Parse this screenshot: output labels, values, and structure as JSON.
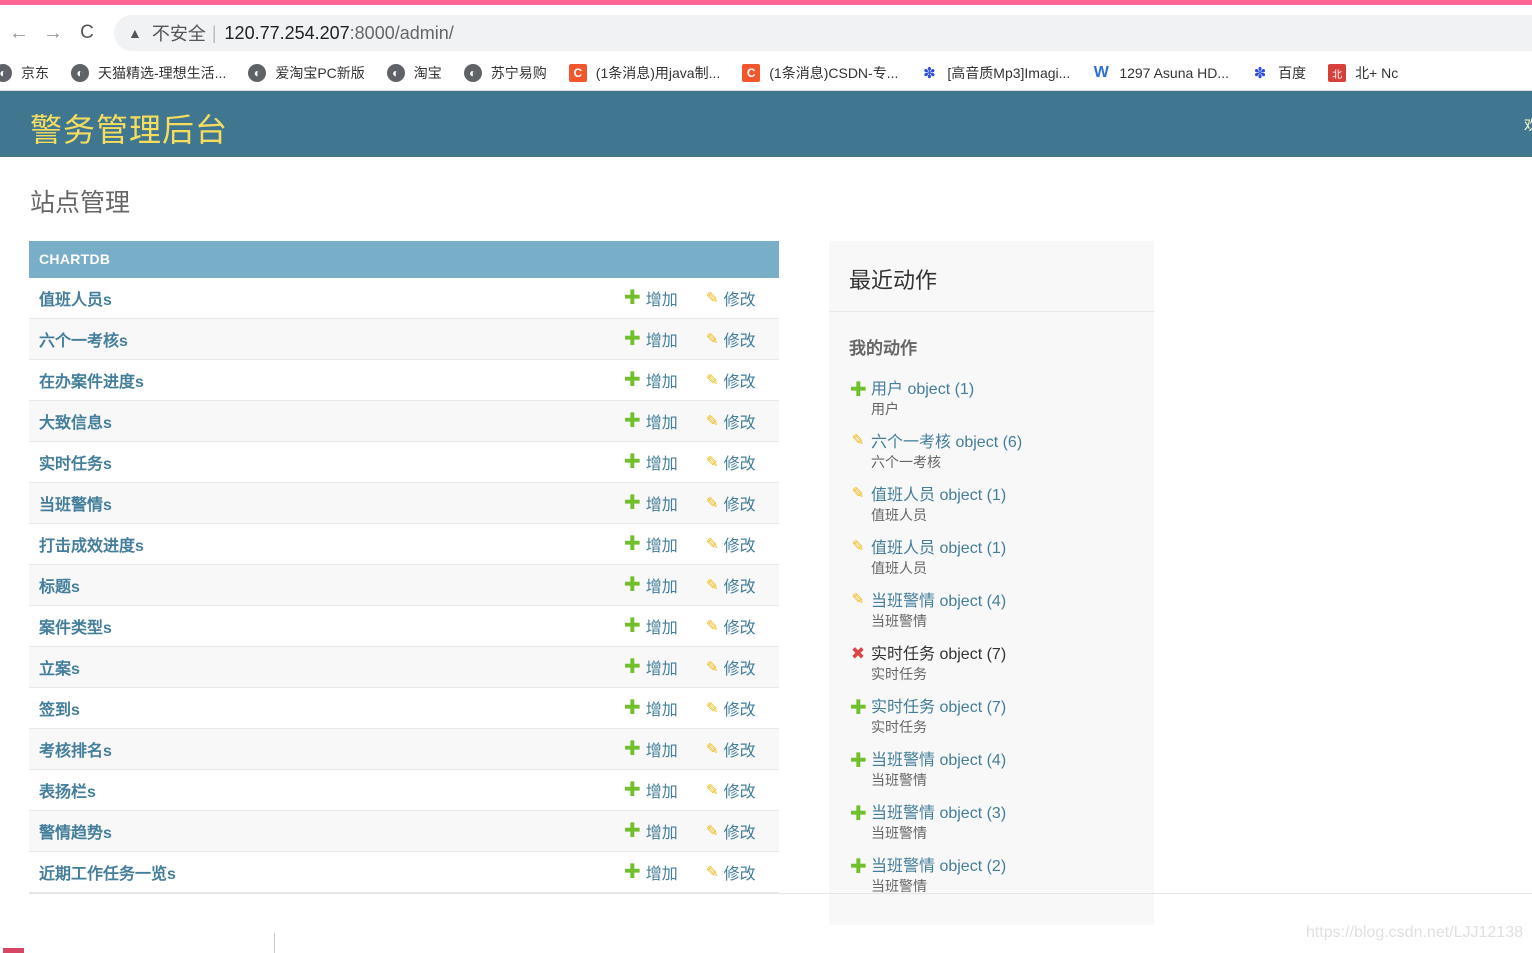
{
  "browser": {
    "back_icon": "←",
    "forward_icon": "→",
    "reload_icon": "C",
    "warning_icon": "▲",
    "insecure_label": "不安全",
    "separator": "|",
    "url_host": "120.77.254.207",
    "url_path": ":8000/admin/",
    "bookmarks": [
      {
        "icon": "globe-icon",
        "glyph": "◐",
        "label": "京东"
      },
      {
        "icon": "globe-icon",
        "glyph": "◐",
        "label": "天猫精选-理想生活..."
      },
      {
        "icon": "globe-icon",
        "glyph": "◐",
        "label": "爱淘宝PC新版"
      },
      {
        "icon": "globe-icon",
        "glyph": "◐",
        "label": "淘宝"
      },
      {
        "icon": "globe-icon",
        "glyph": "◐",
        "label": "苏宁易购"
      },
      {
        "icon": "csdn-icon",
        "glyph": "C",
        "label": "(1条消息)用java制..."
      },
      {
        "icon": "csdn-icon",
        "glyph": "C",
        "label": "(1条消息)CSDN-专..."
      },
      {
        "icon": "baidu-paw-icon",
        "glyph": "✽",
        "label": "[高音质Mp3]Imagi..."
      },
      {
        "icon": "w-icon",
        "glyph": "W",
        "label": "1297 Asuna HD..."
      },
      {
        "icon": "baidu-paw-icon",
        "glyph": "✽",
        "label": "百度"
      },
      {
        "icon": "seal-icon",
        "glyph": "北",
        "label": "北+ Nc"
      }
    ]
  },
  "header": {
    "brand": "警务管理后台",
    "user_fragment": "欢"
  },
  "page": {
    "title": "站点管理"
  },
  "module": {
    "caption": "CHARTDB",
    "add_label": "增加",
    "change_label": "修改",
    "add_glyph": "✚",
    "change_glyph": "✎",
    "models": [
      "值班人员s",
      "六个一考核s",
      "在办案件进度s",
      "大致信息s",
      "实时任务s",
      "当班警情s",
      "打击成效进度s",
      "标题s",
      "案件类型s",
      "立案s",
      "签到s",
      "考核排名s",
      "表扬栏s",
      "警情趋势s",
      "近期工作任务一览s"
    ]
  },
  "recent": {
    "title": "最近动作",
    "mine_label": "我的动作",
    "actions": [
      {
        "type": "add",
        "glyph": "✚",
        "link": "用户 object (1)",
        "content_type": "用户"
      },
      {
        "type": "change",
        "glyph": "✎",
        "link": "六个一考核 object (6)",
        "content_type": "六个一考核"
      },
      {
        "type": "change",
        "glyph": "✎",
        "link": "值班人员 object (1)",
        "content_type": "值班人员"
      },
      {
        "type": "change",
        "glyph": "✎",
        "link": "值班人员 object (1)",
        "content_type": "值班人员"
      },
      {
        "type": "change",
        "glyph": "✎",
        "link": "当班警情 object (4)",
        "content_type": "当班警情"
      },
      {
        "type": "delete",
        "glyph": "✖",
        "link": "实时任务 object (7)",
        "content_type": "实时任务"
      },
      {
        "type": "add",
        "glyph": "✚",
        "link": "实时任务 object (7)",
        "content_type": "实时任务"
      },
      {
        "type": "add",
        "glyph": "✚",
        "link": "当班警情 object (4)",
        "content_type": "当班警情"
      },
      {
        "type": "add",
        "glyph": "✚",
        "link": "当班警情 object (3)",
        "content_type": "当班警情"
      },
      {
        "type": "add",
        "glyph": "✚",
        "link": "当班警情 object (2)",
        "content_type": "当班警情"
      }
    ]
  },
  "watermark": "https://blog.csdn.net/LJJ12138",
  "colors": {
    "header_bg": "#417690",
    "brand_text": "#f5dd5d",
    "caption_bg": "#79aec8",
    "link": "#447e9b",
    "add_icon": "#70bf2b",
    "change_icon": "#efb80b",
    "delete_icon": "#dd4646",
    "top_stripe": "#ff6593"
  }
}
